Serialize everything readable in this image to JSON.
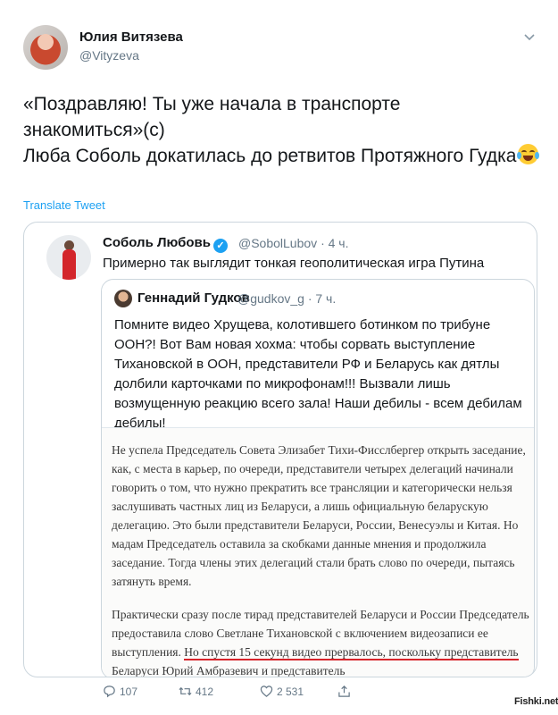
{
  "author": {
    "name": "Юлия Витязева",
    "handle": "@Vityzeva"
  },
  "tweet": {
    "lines": [
      "«Поздравляю! Ты уже начала в транспорте знакомиться»(с)",
      "Люба Соболь докатилась до ретвитов Протяжного Гудка"
    ],
    "emoji": "face-with-tears-of-joy",
    "translate_label": "Translate Tweet"
  },
  "quote": {
    "name": "Соболь Любовь",
    "handle": "@SobolLubov",
    "time": "· 4 ч.",
    "text": "Примерно так выглядит тонкая геополитическая игра Путина",
    "inner": {
      "name": "Геннадий Гудков",
      "handle": "@gudkov_g",
      "time": "· 7 ч.",
      "text": "Помните видео Хрущева, колотившего ботинком по трибуне ООН?! Вот Вам новая хохма: чтобы сорвать выступление Тихановской в ООН, представители РФ и Беларусь как дятлы долбили карточками по микрофонам!!! Вызвали лишь возмущенную реакцию всего зала! Наши дебилы - всем дебилам дебилы!",
      "doc_para1": "Не успела Председатель Совета Элизабет Тихи-Фисслбергер открыть заседание, как, с места в карьер, по очереди, представители четырех делегаций начинали говорить о том, что нужно прекратить все трансляции и категорически нельзя заслушивать частных лиц из Беларуси, а лишь официальную беларускую делегацию. Это были представители Беларуси, России, Венесуэлы и Китая. Но мадам Председатель оставила за скобками данные мнения и продолжила заседание. Тогда члены этих делегаций стали брать слово по очереди, пытаясь затянуть время.",
      "doc_para2_a": "Практически сразу после тирад представителей Беларуси и России Председатель предоставила слово Светлане Тихановской с включением видеозаписи ее выступления. ",
      "doc_para2_b": "Но спустя 15 секунд видео прервалось, поскольку представитель Беларуси Юрий Амбразевич и представитель"
    }
  },
  "actions": {
    "replies": "107",
    "retweets": "412",
    "likes": "2 531"
  },
  "watermark": "Fishki.net",
  "colors": {
    "link": "#1da1f2",
    "muted": "#657786",
    "underline": "#d8232a"
  }
}
